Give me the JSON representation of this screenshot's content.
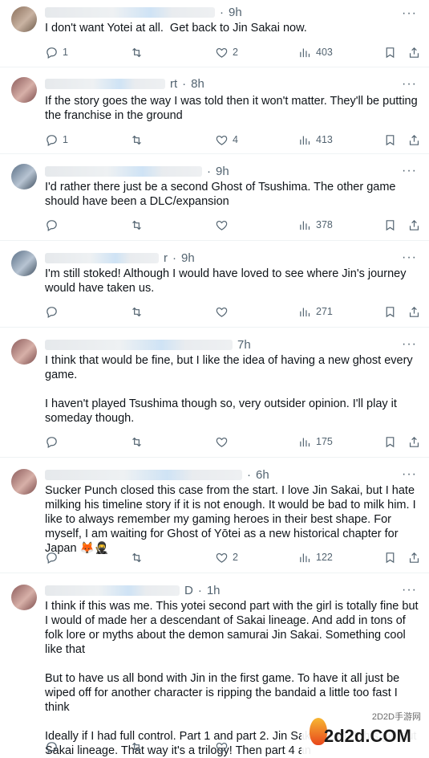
{
  "posts": [
    {
      "time": "9h",
      "text": "I don't want Yotei at all.  Get back to Jin Sakai now.",
      "replies": "1",
      "reposts": "",
      "likes": "2",
      "views": "403"
    },
    {
      "time": "8h",
      "prefix": "rt",
      "text": "If the story goes the way I was told then it won't matter. They'll be putting the franchise in the ground",
      "replies": "1",
      "reposts": "",
      "likes": "4",
      "views": "413"
    },
    {
      "time": "9h",
      "text": "I'd rather there just be a second Ghost of Tsushima. The other game should have been a DLC/expansion",
      "replies": "",
      "reposts": "",
      "likes": "",
      "views": "378"
    },
    {
      "time": "9h",
      "prefix": "r",
      "text": "I'm still stoked! Although I would have loved to see where Jin's journey would have taken us.",
      "replies": "",
      "reposts": "",
      "likes": "",
      "views": "271"
    },
    {
      "time": "7h",
      "text": "I think that would be fine, but I like the idea of having a new ghost every game.\n\nI haven't played Tsushima though so, very outsider opinion. I'll play it someday though.",
      "replies": "",
      "reposts": "",
      "likes": "",
      "views": "175"
    },
    {
      "time": "6h",
      "text": "Sucker Punch closed this case from the start. I love Jin Sakai, but I hate milking his timeline story if it is not enough. It would be bad to milk him. I like to always remember my gaming heroes in their best shape. For myself, I am waiting for Ghost of Yōtei as a new historical chapter for Japan 🦊🥷",
      "replies": "",
      "reposts": "",
      "likes": "2",
      "views": "122"
    },
    {
      "time": "1h",
      "prefix": "D",
      "text": "I think if this was me. This yotei second part with the girl is totally fine but I would of made her a descendant of Sakai lineage. And add in tons of folk lore or myths about the demon samurai Jin Sakai. Something cool like that\n\nBut to have us all bond with Jin in the first game. To have it all just be wiped off for another character is ripping the bandaid a little too fast I think\n\nIdeally if I had full control. Part 1 and part 2. Jin Sakai. Part 3 this girl but Sakai lineage. That way it's a trilogy! Then part 4 an",
      "replies": "",
      "reposts": "",
      "likes": "",
      "views": ""
    }
  ],
  "watermark": {
    "top": "2D2D手游网",
    "main": "2d2d.COM"
  },
  "more_label": "···"
}
